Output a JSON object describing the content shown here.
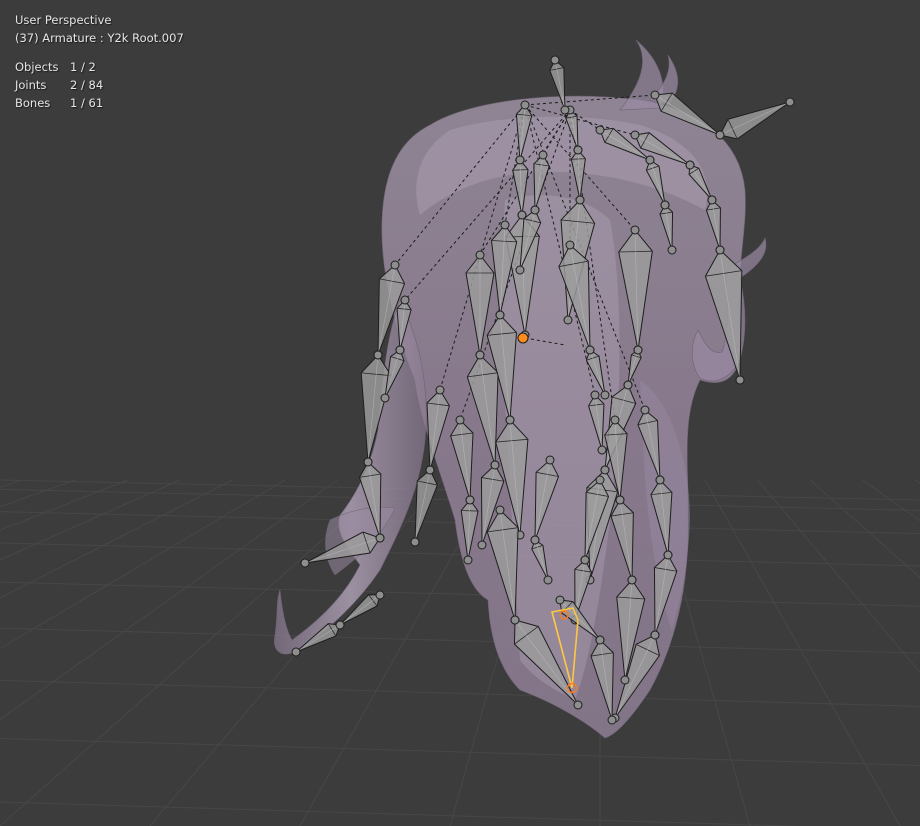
{
  "viewport": {
    "view_name": "User Perspective",
    "active_object": "(37) Armature : Y2k Root.007",
    "stats": [
      {
        "label": "Objects",
        "value": "1 / 2"
      },
      {
        "label": "Joints",
        "value": "2 / 84"
      },
      {
        "label": "Bones",
        "value": "1 / 61"
      }
    ]
  },
  "colors": {
    "background": "#3c3c3c",
    "grid_line": "#4a4a4a",
    "hair_mesh": "#9a8aa3",
    "bone_fill": "#9c9c9c",
    "bone_outline": "#1e1e1e",
    "selected_bone": "#ffaa40",
    "active_joint": "#ff8c1a"
  }
}
